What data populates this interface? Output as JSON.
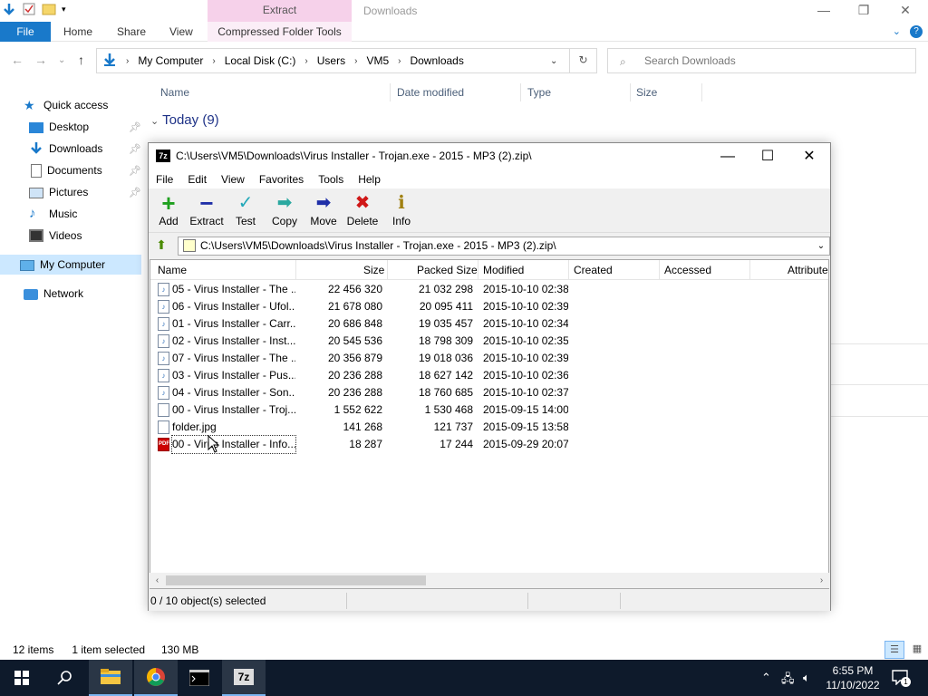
{
  "explorer": {
    "window_title": "Downloads",
    "context_tab_header": "Extract",
    "ribbon_tabs": {
      "file": "File",
      "home": "Home",
      "share": "Share",
      "view": "View",
      "context": "Compressed Folder Tools"
    },
    "address": [
      "My Computer",
      "Local Disk (C:)",
      "Users",
      "VM5",
      "Downloads"
    ],
    "search_placeholder": "Search Downloads",
    "nav_pane": {
      "quick_access": "Quick access",
      "desktop": "Desktop",
      "downloads": "Downloads",
      "documents": "Documents",
      "pictures": "Pictures",
      "music": "Music",
      "videos": "Videos",
      "my_computer": "My Computer",
      "network": "Network"
    },
    "columns": {
      "name": "Name",
      "date_modified": "Date modified",
      "type": "Type",
      "size": "Size"
    },
    "group_header": "Today (9)",
    "status": {
      "items": "12 items",
      "selected": "1 item selected",
      "size": "130 MB"
    }
  },
  "zip": {
    "title": "C:\\Users\\VM5\\Downloads\\Virus Installer - Trojan.exe - 2015 - MP3 (2).zip\\",
    "logo": "7z",
    "menu": [
      "File",
      "Edit",
      "View",
      "Favorites",
      "Tools",
      "Help"
    ],
    "toolbar": {
      "add": "Add",
      "extract": "Extract",
      "test": "Test",
      "copy": "Copy",
      "move": "Move",
      "delete": "Delete",
      "info": "Info"
    },
    "path": "C:\\Users\\VM5\\Downloads\\Virus Installer - Trojan.exe - 2015 - MP3 (2).zip\\",
    "columns": {
      "name": "Name",
      "size": "Size",
      "packed_size": "Packed Size",
      "modified": "Modified",
      "created": "Created",
      "accessed": "Accessed",
      "attributes": "Attribute"
    },
    "rows": [
      {
        "name": "05 - Virus Installer - The ...",
        "size": "22 456 320",
        "packed": "21 032 298",
        "modified": "2015-10-10 02:38",
        "icon": "audio-file-icon"
      },
      {
        "name": "06 - Virus Installer - Ufol...",
        "size": "21 678 080",
        "packed": "20 095 411",
        "modified": "2015-10-10 02:39",
        "icon": "audio-file-icon"
      },
      {
        "name": "01 - Virus Installer - Carr...",
        "size": "20 686 848",
        "packed": "19 035 457",
        "modified": "2015-10-10 02:34",
        "icon": "audio-file-icon"
      },
      {
        "name": "02 - Virus Installer - Inst...",
        "size": "20 545 536",
        "packed": "18 798 309",
        "modified": "2015-10-10 02:35",
        "icon": "audio-file-icon"
      },
      {
        "name": "07 - Virus Installer - The ...",
        "size": "20 356 879",
        "packed": "19 018 036",
        "modified": "2015-10-10 02:39",
        "icon": "audio-file-icon"
      },
      {
        "name": "03 - Virus Installer - Pus...",
        "size": "20 236 288",
        "packed": "18 627 142",
        "modified": "2015-10-10 02:36",
        "icon": "audio-file-icon"
      },
      {
        "name": "04 - Virus Installer - Son...",
        "size": "20 236 288",
        "packed": "18 760 685",
        "modified": "2015-10-10 02:37",
        "icon": "audio-file-icon"
      },
      {
        "name": "00 - Virus Installer - Troj...",
        "size": "1 552 622",
        "packed": "1 530 468",
        "modified": "2015-09-15 14:00",
        "icon": "file-icon"
      },
      {
        "name": "folder.jpg",
        "size": "141 268",
        "packed": "121 737",
        "modified": "2015-09-15 13:58",
        "icon": "image-file-icon"
      },
      {
        "name": "00 - Virus Installer - Info...",
        "size": "18 287",
        "packed": "17 244",
        "modified": "2015-09-29 20:07",
        "icon": "pdf-file-icon"
      }
    ],
    "status": "0 / 10 object(s) selected"
  },
  "taskbar": {
    "time": "6:55 PM",
    "date": "11/10/2022",
    "notification_count": "1",
    "zip_button_label": "7z"
  }
}
